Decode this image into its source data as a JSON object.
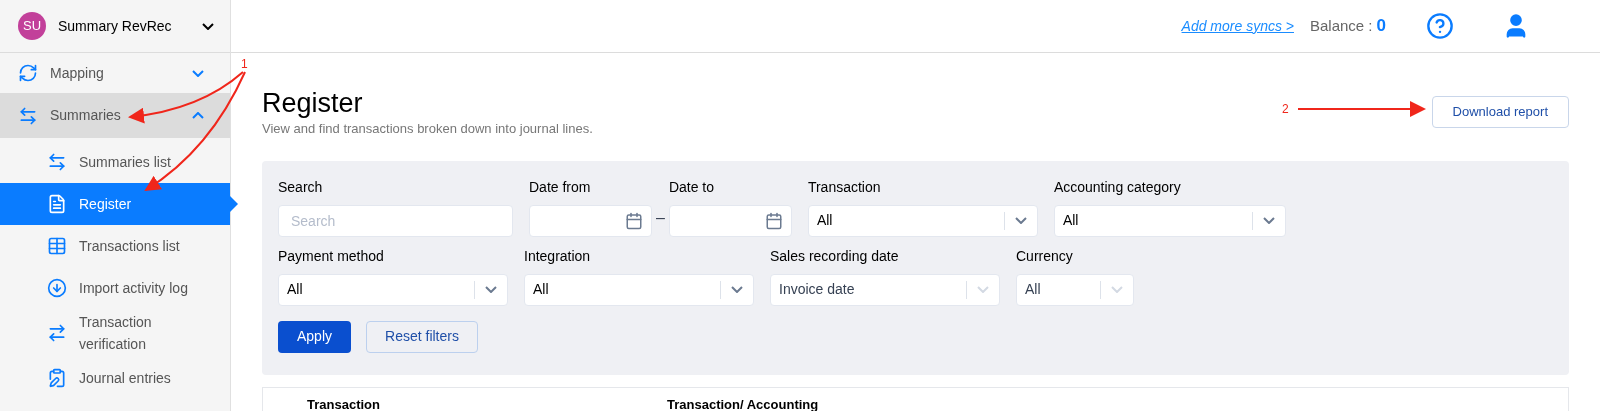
{
  "workspace": {
    "initials": "SU",
    "name": "Summary RevRec"
  },
  "sidebar": {
    "items": [
      {
        "label": "Mapping",
        "expanded": false
      },
      {
        "label": "Summaries",
        "expanded": true,
        "children": [
          {
            "label": "Summaries list",
            "selected": false
          },
          {
            "label": "Register",
            "selected": true
          },
          {
            "label": "Transactions list",
            "selected": false
          },
          {
            "label": "Import activity log",
            "selected": false
          },
          {
            "label": "Transaction verification",
            "selected": false
          },
          {
            "label": "Journal entries",
            "selected": false
          }
        ]
      }
    ]
  },
  "topbar": {
    "link": "Add more syncs >",
    "balance_label": "Balance :",
    "balance_value": "0"
  },
  "page": {
    "title": "Register",
    "subtitle": "View and find transactions broken down into journal lines.",
    "action": "Download report"
  },
  "filters": {
    "fields": [
      {
        "kind": "text",
        "label": "Search",
        "placeholder": "Search"
      },
      {
        "kind": "date",
        "label": "Date from"
      },
      {
        "kind": "separator",
        "text": "–"
      },
      {
        "kind": "date",
        "label": "Date to"
      },
      {
        "kind": "select",
        "label": "Transaction",
        "value": "All",
        "disabled": false
      },
      {
        "kind": "select",
        "label": "Accounting category",
        "value": "All",
        "disabled": false
      },
      {
        "kind": "select",
        "label": "Payment method",
        "value": "All",
        "disabled": false
      },
      {
        "kind": "select",
        "label": "Integration",
        "value": "All",
        "disabled": false
      },
      {
        "kind": "select",
        "label": "Sales recording date",
        "value": "Invoice date",
        "disabled": true
      },
      {
        "kind": "select",
        "label": "Currency",
        "value": "All",
        "disabled": true
      }
    ],
    "apply": "Apply",
    "reset": "Reset filters"
  },
  "table": {
    "columns": [
      "Transaction",
      "Transaction/ Accounting"
    ]
  },
  "annotations": [
    {
      "label": "1"
    },
    {
      "label": "2"
    }
  ]
}
